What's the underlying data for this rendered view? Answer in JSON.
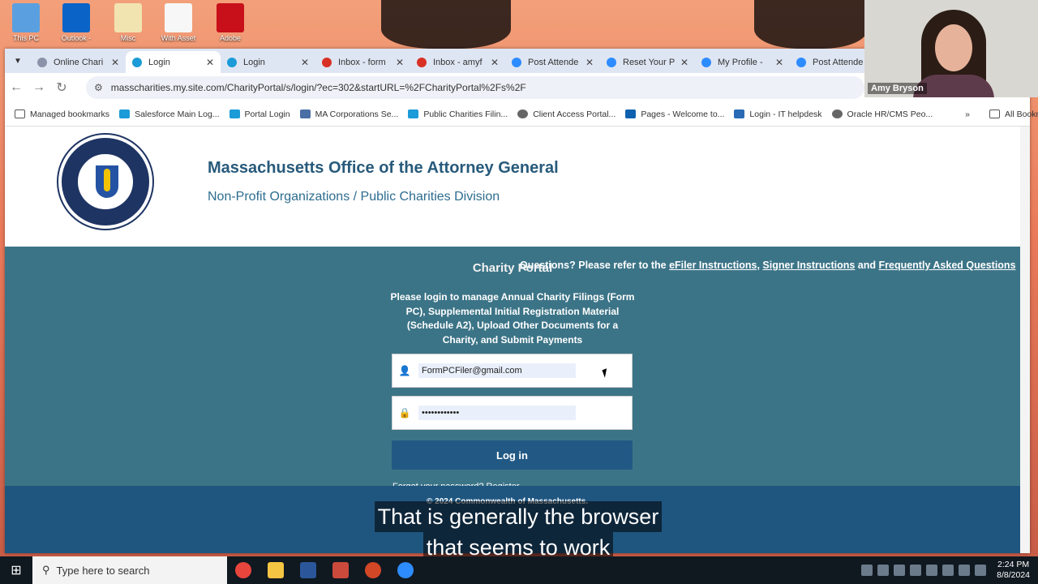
{
  "desktop": {
    "icons": [
      "This PC",
      "Outlook -",
      "Misc",
      "With Asset",
      "Adobe"
    ]
  },
  "tabs": [
    {
      "label": "Online Chari",
      "active": false
    },
    {
      "label": "Login",
      "active": true
    },
    {
      "label": "Login",
      "active": false
    },
    {
      "label": "Inbox - form",
      "active": false
    },
    {
      "label": "Inbox - amyf",
      "active": false
    },
    {
      "label": "Post Attende",
      "active": false
    },
    {
      "label": "Reset Your P",
      "active": false
    },
    {
      "label": "My Profile -",
      "active": false
    },
    {
      "label": "Post Attende",
      "active": false
    }
  ],
  "address": {
    "url": "masscharities.my.site.com/CharityPortal/s/login/?ec=302&startURL=%2FCharityPortal%2Fs%2F"
  },
  "bookmarks": {
    "items": [
      "Managed bookmarks",
      "Salesforce Main Log...",
      "Portal Login",
      "MA Corporations Se...",
      "Public Charities Filin...",
      "Client Access Portal...",
      "Pages - Welcome to...",
      "Login - IT helpdesk",
      "Oracle HR/CMS Peo..."
    ],
    "more": "»",
    "all": "All Bookmarks"
  },
  "header": {
    "title": "Massachusetts Office of the Attorney General",
    "subtitle": "Non-Profit Organizations / Public Charities Division"
  },
  "portal": {
    "questions_prefix": "Questions? Please refer to the ",
    "link1": "eFiler Instructions,",
    "link2": "Signer Instructions",
    "and": " and ",
    "link3": "Frequently Asked Questions",
    "title": "Charity Portal",
    "description": "Please login to manage Annual Charity Filings (Form PC), Supplemental Initial Registration Material (Schedule A2), Upload Other Documents for a Charity, and Submit Payments",
    "username": "FormPCFiler@gmail.com",
    "password": "••••••••••••",
    "login_button": "Log in",
    "forgot": "Forgot your password? Register"
  },
  "footer": {
    "copyright": "© 2024 Commonwealth of Massachusetts."
  },
  "caption": {
    "line1": "That is generally the browser",
    "line2": "that seems to work"
  },
  "webcam": {
    "name": "Amy Bryson"
  },
  "taskbar": {
    "search_placeholder": "Type here to search",
    "time": "2:24 PM",
    "date": "8/8/2024"
  }
}
